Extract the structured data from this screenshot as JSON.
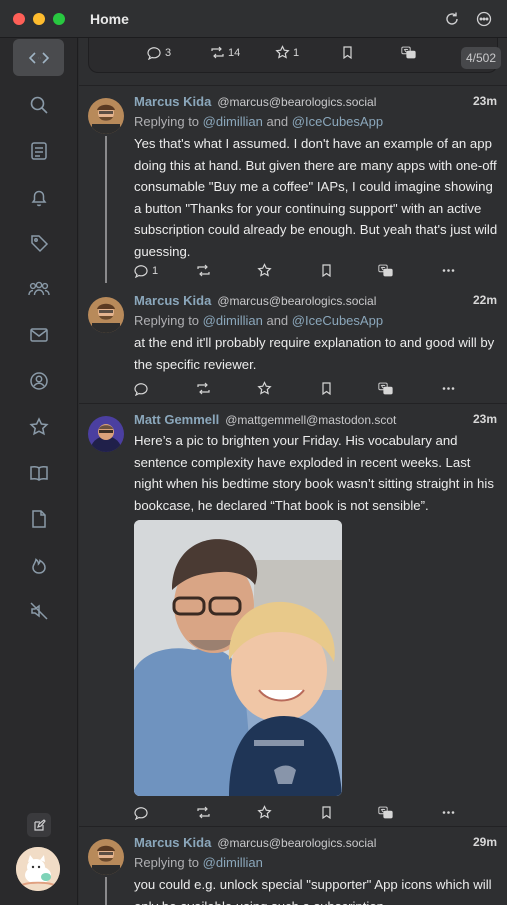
{
  "window": {
    "title": "Home"
  },
  "sidebar": {
    "items": [
      {
        "icon": "code-brackets-icon",
        "label": "Home",
        "active": true
      },
      {
        "icon": "search-icon",
        "label": "Explore"
      },
      {
        "icon": "timeline-icon",
        "label": "Timeline"
      },
      {
        "icon": "bell-icon",
        "label": "Notifications"
      },
      {
        "icon": "tag-icon",
        "label": "Tags"
      },
      {
        "icon": "people-icon",
        "label": "Lists"
      },
      {
        "icon": "envelope-icon",
        "label": "Messages"
      },
      {
        "icon": "profile-icon",
        "label": "Profile"
      },
      {
        "icon": "star-icon",
        "label": "Favorites"
      },
      {
        "icon": "book-icon",
        "label": "Bookmarks"
      },
      {
        "icon": "document-icon",
        "label": "Drafts"
      },
      {
        "icon": "flame-icon",
        "label": "Trending"
      },
      {
        "icon": "muted-speaker-icon",
        "label": "Muted"
      }
    ]
  },
  "top_post": {
    "replies": "3",
    "boosts": "14",
    "favorites": "1",
    "counter": "4/502"
  },
  "posts": [
    {
      "author": "Marcus Kida",
      "handle": "@marcus@bearologics.social",
      "time": "23m",
      "reply_prefix": "Replying to",
      "reply_to": [
        "@dimillian",
        "@IceCubesApp"
      ],
      "reply_and": "and",
      "content": "Yes that's what I assumed. I don't have an example of an app doing this at hand. But given there are many apps with one-off consumable \"Buy me a coffee\" IAPs, I could imagine showing a button \"Thanks for your continuing support\" with an active subscription could already be enough. But yeah that's just wild guessing.",
      "replies": "1"
    },
    {
      "author": "Marcus Kida",
      "handle": "@marcus@bearologics.social",
      "time": "22m",
      "reply_prefix": "Replying to",
      "reply_to": [
        "@dimillian",
        "@IceCubesApp"
      ],
      "reply_and": "and",
      "content": "at the end it'll probably require explanation to and good will by the specific reviewer."
    },
    {
      "author": "Matt Gemmell",
      "handle": "@mattgemmell@mastodon.scot",
      "time": "23m",
      "content": "Here’s a pic to brighten your Friday. His vocabulary and sentence complexity have exploded in recent weeks. Last night when his bedtime story book wasn’t sitting straight in his bookcase, he declared “That book is not sensible”."
    },
    {
      "author": "Marcus Kida",
      "handle": "@marcus@bearologics.social",
      "time": "29m",
      "reply_prefix": "Replying to",
      "reply_to": [
        "@dimillian"
      ],
      "content": "you could e.g. unlock special \"supporter\" App icons which will only be available using such a subscription."
    }
  ],
  "colors": {
    "accent": "#8ba7bb",
    "background": "#2e2f31",
    "sidebar": "#2a2a2c"
  }
}
